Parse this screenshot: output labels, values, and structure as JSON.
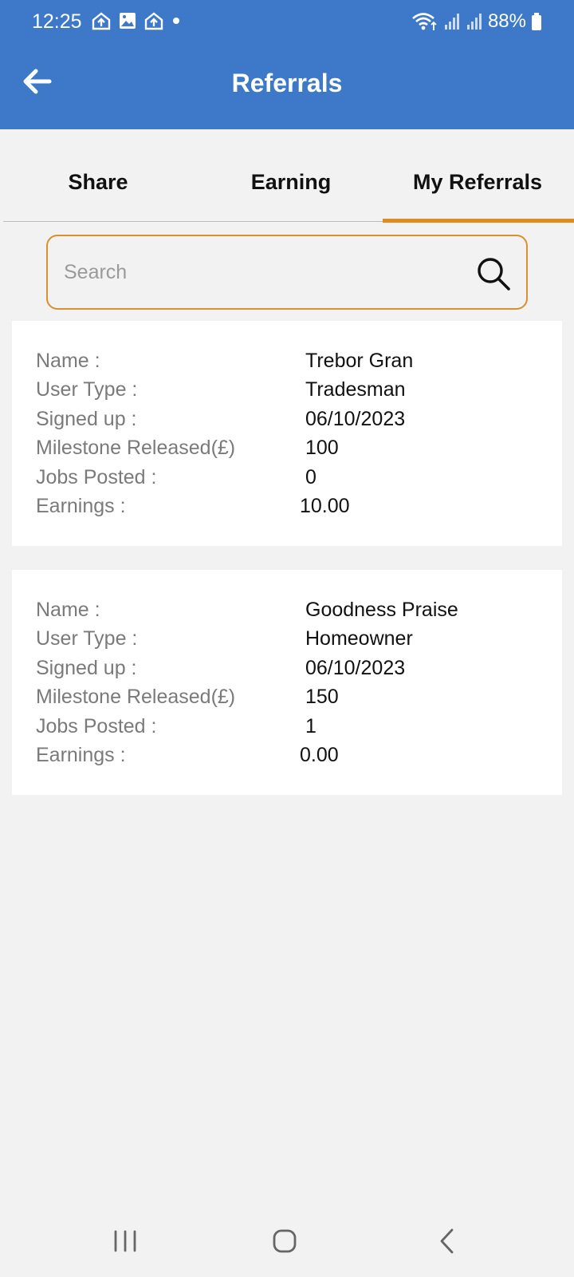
{
  "status_bar": {
    "time": "12:25",
    "notification_icons": [
      "home-upload-icon",
      "image-icon",
      "home-upload-icon",
      "dot-icon"
    ],
    "battery_percent": "88%"
  },
  "header": {
    "title": "Referrals",
    "background_color": "#3d78c9"
  },
  "tabs": [
    {
      "label": "Share",
      "active": false
    },
    {
      "label": "Earning",
      "active": false
    },
    {
      "label": "My Referrals",
      "active": true
    }
  ],
  "accent_color": "#e08a1e",
  "search": {
    "placeholder": "Search",
    "value": ""
  },
  "referrals": [
    {
      "name_label": "Name :",
      "name": "Trebor Gran",
      "user_type_label": "User Type :",
      "user_type": "Tradesman",
      "signed_up_label": "Signed up :",
      "signed_up": "06/10/2023",
      "milestone_label": "Milestone Released(£)",
      "milestone": "100",
      "jobs_label": "Jobs Posted :",
      "jobs": "0",
      "earnings_label": "Earnings :",
      "earnings": "10.00"
    },
    {
      "name_label": "Name :",
      "name": "Goodness Praise",
      "user_type_label": "User Type :",
      "user_type": "Homeowner",
      "signed_up_label": "Signed up :",
      "signed_up": "06/10/2023",
      "milestone_label": "Milestone Released(£)",
      "milestone": "150",
      "jobs_label": "Jobs Posted :",
      "jobs": "1",
      "earnings_label": "Earnings :",
      "earnings": "0.00"
    }
  ],
  "nav_bar": [
    "recent-apps-icon",
    "home-icon",
    "back-icon"
  ]
}
